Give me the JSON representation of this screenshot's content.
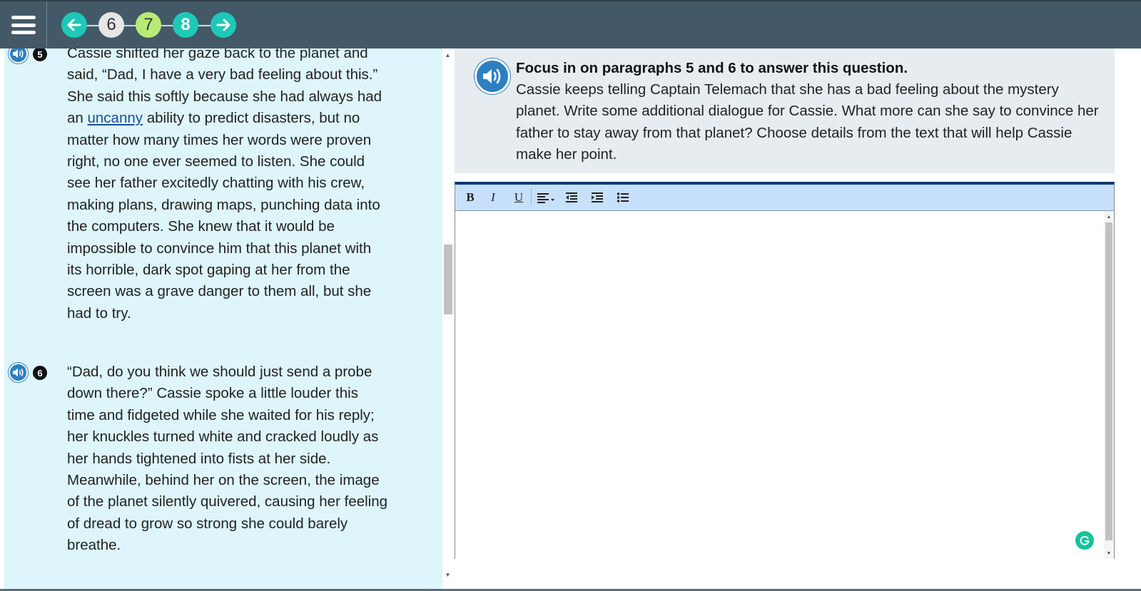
{
  "nav": {
    "questions": [
      "6",
      "7",
      "8"
    ],
    "current": "7"
  },
  "passage": {
    "paragraphs": [
      {
        "number": "5",
        "text_before": "Cassie shifted her gaze back to the planet and said, “Dad, I have a very bad feeling about this.” She said this softly because she had always had an ",
        "vocab_word": "uncanny",
        "text_after": " ability to predict disasters, but no matter how many times her words were proven right, no one ever seemed to listen. She could see her father excitedly chatting with his crew, making plans, drawing maps, punching data into the computers. She knew that it would be impossible to convince him that this planet with its horrible, dark spot gaping at her from the screen was a grave danger to them all, but she had to try."
      },
      {
        "number": "6",
        "text": "“Dad, do you think we should just send a probe down there?” Cassie spoke a little louder this time and fidgeted while she waited for his reply; her knuckles turned white and cracked loudly as her hands tightened into fists at her side. Meanwhile, behind her on the screen, the image of the planet silently quivered, causing her feeling of dread to grow so strong she could barely breathe."
      }
    ]
  },
  "question": {
    "title": "Focus in on paragraphs 5 and 6 to answer this question.",
    "body": "Cassie keeps telling Captain Telemach that she has a bad feeling about the mystery planet. Write some additional dialogue for Cassie. What more can she say to convince her father to stay away from that planet? Choose details from the text that will help Cassie make her point."
  },
  "editor": {
    "toolbar": {
      "bold": "B",
      "italic": "I",
      "underline": "U"
    },
    "content": ""
  },
  "colors": {
    "header": "#435967",
    "accent_teal": "#1ec9b7",
    "current_green": "#b7eb77",
    "passage_bg": "#def5fb",
    "speaker_blue": "#2c7fc1"
  }
}
